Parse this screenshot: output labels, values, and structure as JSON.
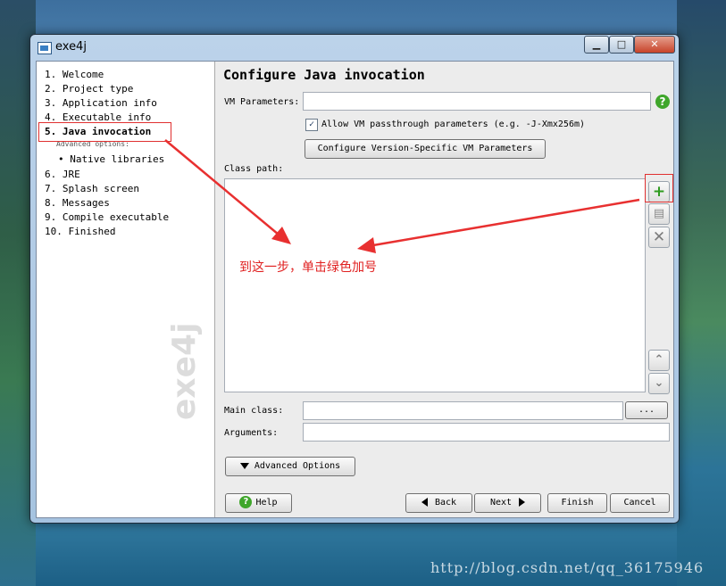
{
  "window": {
    "title": "exe4j"
  },
  "controls": {
    "minimize": "▁",
    "maximize": "□",
    "close": "✕"
  },
  "sidebar": {
    "steps": [
      {
        "label": "1.  Welcome"
      },
      {
        "label": "2.  Project type"
      },
      {
        "label": "3.  Application info"
      },
      {
        "label": "4.  Executable info"
      },
      {
        "label": "5.  Java invocation"
      },
      {
        "label": "6.  JRE"
      },
      {
        "label": "7.  Splash screen"
      },
      {
        "label": "8.  Messages"
      },
      {
        "label": "9.  Compile executable"
      },
      {
        "label": "10.  Finished"
      }
    ],
    "advanced_label": "Advanced options:",
    "sub_step": "• Native libraries",
    "logo": "exe4j"
  },
  "main": {
    "heading": "Configure Java invocation",
    "vm_params_label": "VM Parameters:",
    "vm_params_value": "",
    "help_icon": "?",
    "allow_passthrough_label": "Allow VM passthrough parameters (e.g. -J-Xmx256m)",
    "allow_passthrough_checked": true,
    "check_mark": "✓",
    "configure_vm_button": "Configure Version-Specific VM Parameters",
    "class_path_label": "Class path:",
    "main_class_label": "Main class:",
    "main_class_value": "",
    "browse_button": "...",
    "arguments_label": "Arguments:",
    "arguments_value": "",
    "advanced_options_button": "Advanced Options"
  },
  "side_buttons": {
    "add": "+",
    "edit": "▤",
    "remove": "✕",
    "up": "⌃",
    "down": "⌄"
  },
  "footer": {
    "help": "Help",
    "help_icon": "?",
    "back": "Back",
    "next": "Next",
    "finish": "Finish",
    "cancel": "Cancel"
  },
  "annotation": {
    "text": "到这一步，单击绿色加号",
    "color": "#e02020"
  },
  "page_watermark": "http://blog.csdn.net/qq_36175946",
  "colors": {
    "accent_green": "#3fa62b",
    "highlight_red": "#e03030"
  }
}
